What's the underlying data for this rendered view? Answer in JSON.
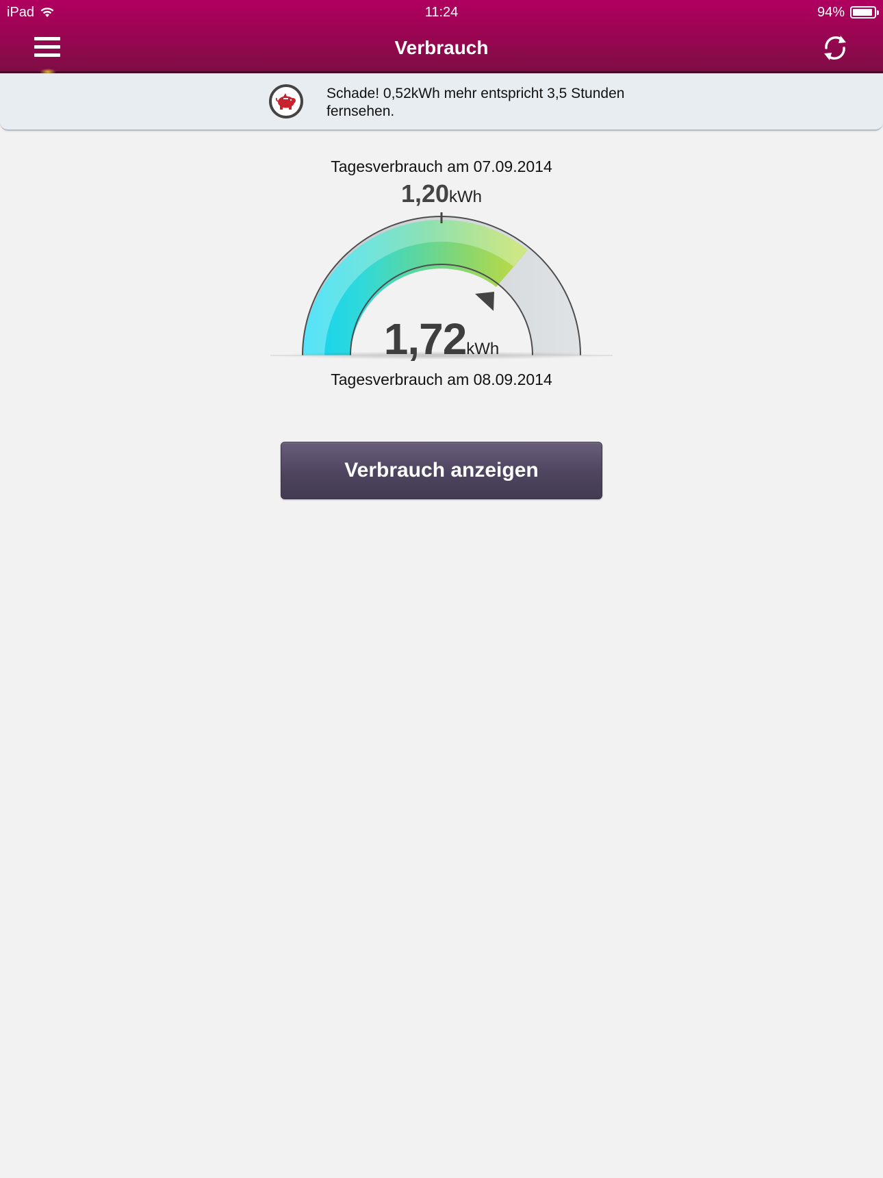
{
  "status_bar": {
    "carrier": "iPad",
    "time": "11:24",
    "battery": "94%",
    "battery_level": 0.94
  },
  "nav": {
    "title": "Verbrauch",
    "menu_icon": "hamburger-menu-icon",
    "refresh_icon": "refresh-icon"
  },
  "banner": {
    "icon": "piggy-bank-icon",
    "text": "Schade! 0,52kWh mehr entspricht 3,5 Stunden fernsehen."
  },
  "gauge": {
    "previous_label": "Tagesverbrauch am 07.09.2014",
    "previous_value": "1,20",
    "previous_unit": "kWh",
    "current_value": "1,72",
    "current_unit": "kWh",
    "current_label": "Tagesverbrauch am 08.09.2014",
    "colors": {
      "cyan": "#0fd3f5",
      "green": "#7fd67f",
      "lime": "#b5d94a",
      "gray": "#c8ced2"
    }
  },
  "action": {
    "label": "Verbrauch anzeigen"
  },
  "theme": {
    "header_color": "#9c0553",
    "button_color": "#4e445f",
    "background": "#f2f2f2"
  }
}
